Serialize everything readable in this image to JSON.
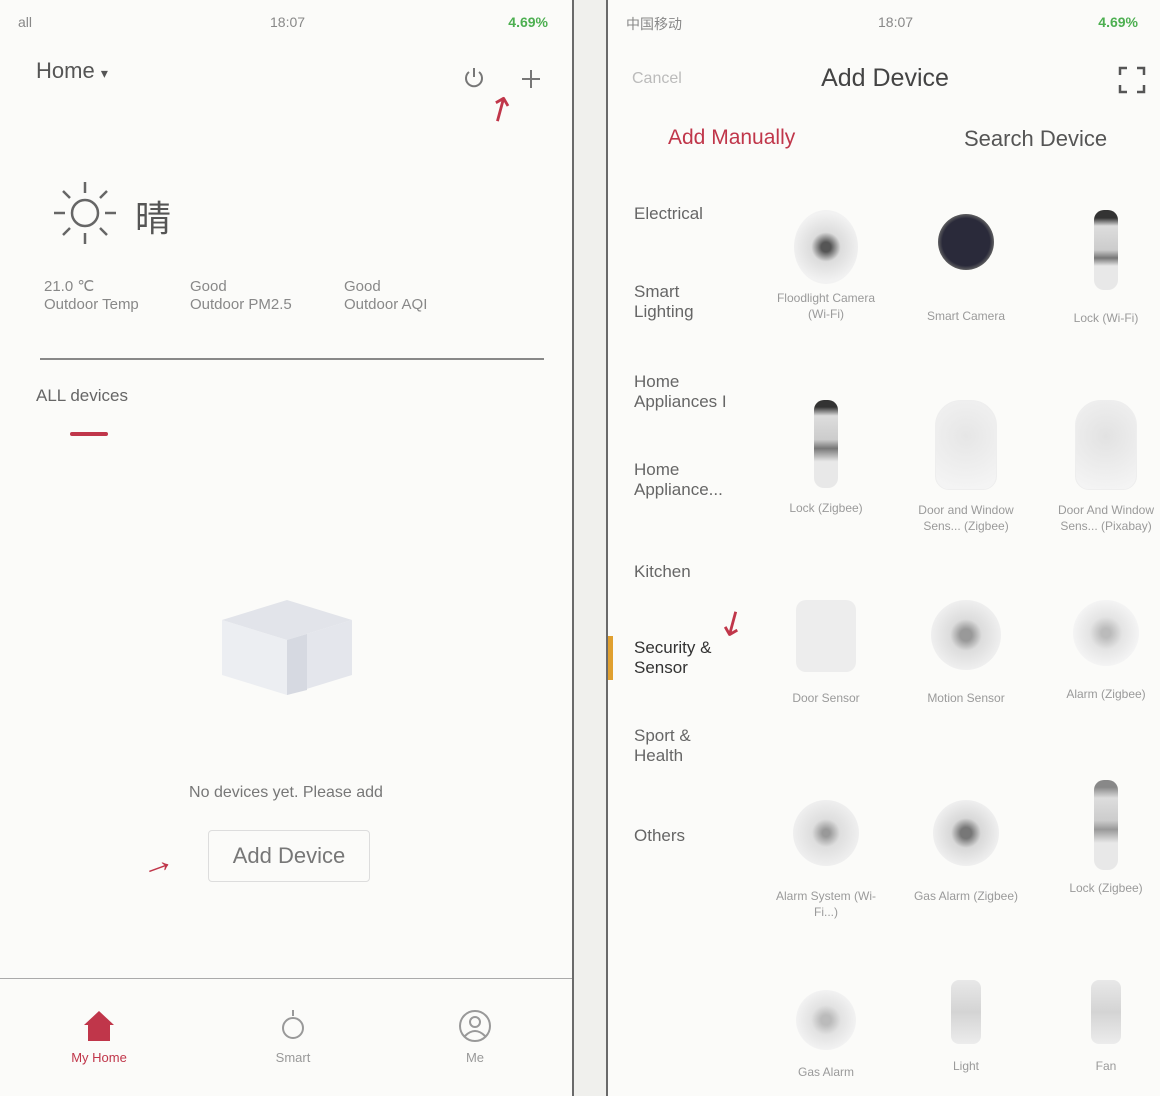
{
  "left": {
    "status": {
      "carrier": "all",
      "time": "18:07",
      "battery": "4.69%"
    },
    "header": {
      "home_label": "Home",
      "dropdown_glyph": "▾"
    },
    "weather": {
      "condition": "晴",
      "stats": [
        {
          "value": "21.0 ℃",
          "label": "Outdoor Temp"
        },
        {
          "value": "Good",
          "label": "Outdoor PM2.5"
        },
        {
          "value": "Good",
          "label": "Outdoor AQI"
        }
      ]
    },
    "section_title": "ALL devices",
    "empty_text": "No devices yet. Please add",
    "add_button": "Add Device",
    "tabbar": [
      "My Home",
      "Smart",
      "Me"
    ]
  },
  "right": {
    "status": {
      "carrier": "中国移动",
      "time": "18:07",
      "battery": "4.69%"
    },
    "header": {
      "cancel": "Cancel",
      "title": "Add Device"
    },
    "tabs": {
      "manual": "Add Manually",
      "search": "Search Device"
    },
    "categories": [
      "Electrical",
      "Smart Lighting",
      "Home Appliances I",
      "Home Appliance...",
      "Kitchen",
      "Security & Sensor",
      "Sport & Health",
      "Others"
    ],
    "devices": [
      {
        "label": "Floodlight Camera (Wi-Fi)"
      },
      {
        "label": "Smart Camera"
      },
      {
        "label": "Lock (Wi-Fi)"
      },
      {
        "label": "Lock (Zigbee)"
      },
      {
        "label": "Door and Window Sens... (Zigbee)"
      },
      {
        "label": "Door And Window Sens... (Pixabay)"
      },
      {
        "label": "Door Sensor"
      },
      {
        "label": "Motion Sensor"
      },
      {
        "label": "Alarm (Zigbee)"
      },
      {
        "label": "Alarm System (Wi-Fi...)"
      },
      {
        "label": "Gas Alarm (Zigbee)"
      },
      {
        "label": "Lock (Zigbee)"
      },
      {
        "label": "Gas Alarm"
      },
      {
        "label": "Light"
      },
      {
        "label": "Fan"
      }
    ]
  },
  "colors": {
    "accent": "#c0364a",
    "battery": "#4caf50"
  }
}
